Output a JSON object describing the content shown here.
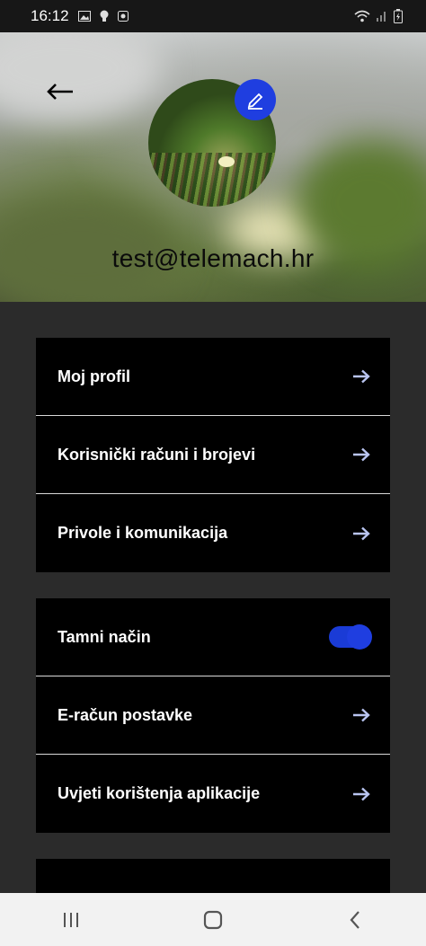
{
  "status_bar": {
    "time": "16:12",
    "left_icons": [
      "image-icon",
      "bulb-icon",
      "app-icon"
    ],
    "right_icons": [
      "wifi-icon",
      "signal-icon",
      "battery-icon"
    ]
  },
  "header": {
    "email": "test@telemach.hr"
  },
  "menu_group_1": [
    {
      "label": "Moj profil"
    },
    {
      "label": "Korisnički računi i brojevi"
    },
    {
      "label": "Privole i komunikacija"
    }
  ],
  "menu_group_2": [
    {
      "label": "Tamni način",
      "toggle": true
    },
    {
      "label": "E-račun postavke"
    },
    {
      "label": "Uvjeti korištenja aplikacije"
    }
  ],
  "colors": {
    "accent": "#1f3ee0",
    "arrow": "#b9c4f0",
    "card": "#000000",
    "background": "#2b2b2b"
  }
}
